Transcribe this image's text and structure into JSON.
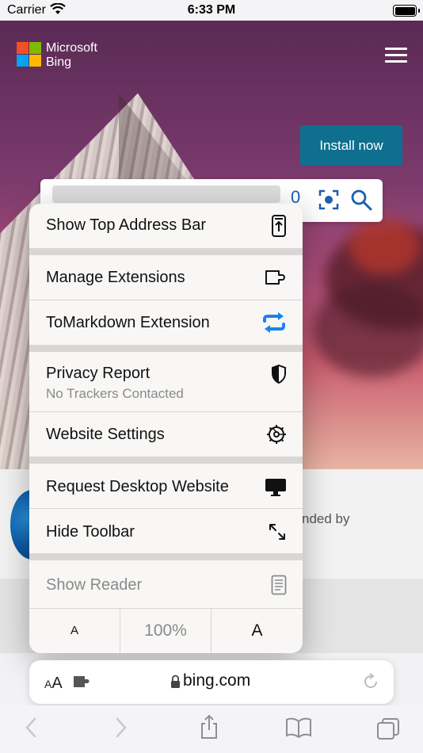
{
  "status_bar": {
    "carrier": "Carrier",
    "time": "6:33 PM"
  },
  "brand": {
    "line1": "Microsoft",
    "line2": "Bing"
  },
  "search": {
    "partial_text": "0"
  },
  "page": {
    "recommended_partial": "nded by",
    "install_label": "Install now"
  },
  "menu": {
    "items": [
      {
        "label": "Show Top Address Bar",
        "icon": "address-bar-top-icon"
      },
      {
        "label": "Manage Extensions",
        "icon": "puzzle-icon"
      },
      {
        "label": "ToMarkdown Extension",
        "icon": "repeat-arrows-icon"
      },
      {
        "label": "Privacy Report",
        "sub": "No Trackers Contacted",
        "icon": "shield-icon"
      },
      {
        "label": "Website Settings",
        "icon": "gear-icon"
      },
      {
        "label": "Request Desktop Website",
        "icon": "desktop-icon"
      },
      {
        "label": "Hide Toolbar",
        "icon": "expand-arrows-icon"
      },
      {
        "label": "Show Reader",
        "icon": "reader-icon"
      }
    ],
    "zoom": {
      "smaller": "A",
      "value": "100%",
      "larger": "A"
    }
  },
  "address_bar": {
    "text_size_label": "AA",
    "url": "bing.com"
  },
  "colors": {
    "accent": "#1a73e8",
    "install": "#0f6f8f",
    "extension_icon": "#1a82f0"
  }
}
